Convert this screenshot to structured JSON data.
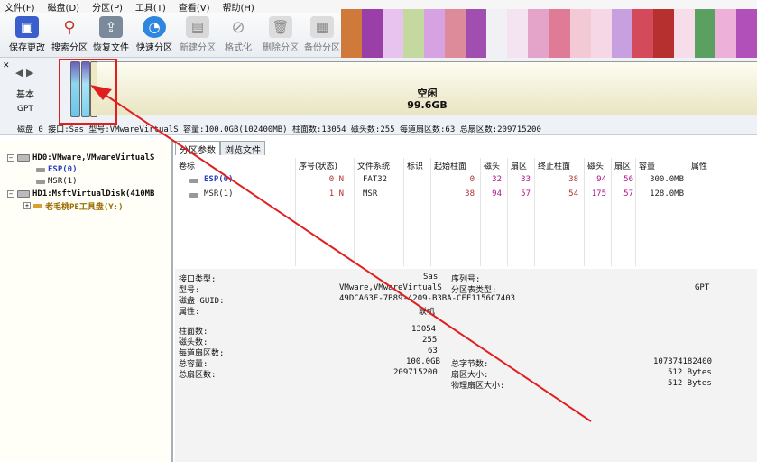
{
  "menu": [
    "文件(F)",
    "磁盘(D)",
    "分区(P)",
    "工具(T)",
    "查看(V)",
    "帮助(H)"
  ],
  "toolbar": [
    {
      "label": "保存更改",
      "icon": "save-icon",
      "color": "#3a5fcd"
    },
    {
      "label": "搜索分区",
      "icon": "search-icon",
      "color": "#c0392b"
    },
    {
      "label": "恢复文件",
      "icon": "restore-icon",
      "color": "#7a8a9a"
    },
    {
      "label": "快速分区",
      "icon": "partition-icon",
      "color": "#2e86de"
    },
    {
      "label": "新建分区",
      "icon": "new-partition-icon",
      "color": "#999999"
    },
    {
      "label": "格式化",
      "icon": "format-icon",
      "color": "#999999"
    },
    {
      "label": "删除分区",
      "icon": "delete-icon",
      "color": "#999999"
    },
    {
      "label": "备份分区",
      "icon": "backup-icon",
      "color": "#999999"
    }
  ],
  "diskbar": {
    "type": "基本",
    "scheme": "GPT",
    "free_label": "空闲",
    "free_size": "99.6GB",
    "info": "磁盘 0 接口:Sas 型号:VMwareVirtualS 容量:100.0GB(102400MB) 柱面数:13054 磁头数:255 每道扇区数:63 总扇区数:209715200"
  },
  "tree": {
    "hd0": "HD0:VMware,VMwareVirtualS",
    "esp": "ESP(0)",
    "msr": "MSR(1)",
    "hd1": "HD1:MsftVirtualDisk(410MB",
    "tool": "老毛桃PE工具盘(Y:)"
  },
  "tabs": [
    "分区参数",
    "浏览文件"
  ],
  "grid": {
    "headers": [
      "卷标",
      "序号(状态)",
      "文件系统",
      "标识",
      "起始柱面",
      "磁头",
      "扇区",
      "终止柱面",
      "磁头",
      "扇区",
      "容量",
      "属性"
    ],
    "rows": [
      [
        "ESP(0)",
        "0 N",
        "FAT32",
        "",
        "0",
        "32",
        "33",
        "38",
        "94",
        "56",
        "300.0MB",
        ""
      ],
      [
        "MSR(1)",
        "1 N",
        "MSR",
        "",
        "38",
        "94",
        "57",
        "54",
        "175",
        "57",
        "128.0MB",
        ""
      ]
    ]
  },
  "info": {
    "iface_label": "接口类型:",
    "iface": "Sas",
    "serial_label": "序列号:",
    "model_label": "型号:",
    "model": "VMware,VMwareVirtualS",
    "pt_label": "分区表类型:",
    "pt": "GPT",
    "guid_label": "磁盘 GUID:",
    "guid": "49DCA63E-7B89-4209-B3BA-CEF1156C7403",
    "attr_label": "属性:",
    "attr": "联机",
    "cyl_label": "柱面数:",
    "cyl": "13054",
    "heads_label": "磁头数:",
    "heads": "255",
    "spt_label": "每道扇区数:",
    "spt": "63",
    "cap_label": "总容量:",
    "cap": "100.0GB",
    "bytes_label": "总字节数:",
    "bytes": "107374182400",
    "sectors_label": "总扇区数:",
    "sectors": "209715200",
    "ss_label": "扇区大小:",
    "ss": "512 Bytes",
    "pss_label": "物理扇区大小:",
    "pss": "512 Bytes"
  },
  "colors": {
    "highlight": "#e02020",
    "selection": "#1f57b8",
    "partition_text": "#2a3fc0",
    "tool_text": "#9a6a00"
  }
}
